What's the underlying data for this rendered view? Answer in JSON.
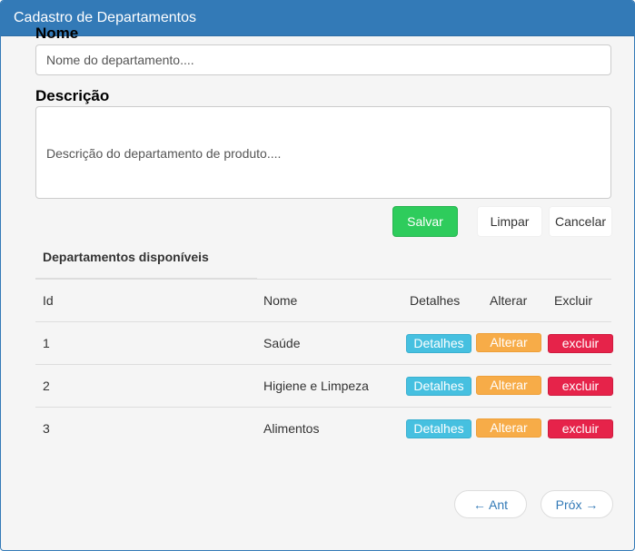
{
  "panel": {
    "title": "Cadastro de Departamentos"
  },
  "form": {
    "nome_label": "Nome",
    "nome_placeholder": "Nome do departamento....",
    "descricao_label": "Descrição",
    "descricao_placeholder": "Descrição do departamento de produto....",
    "save_label": "Salvar",
    "clear_label": "Limpar",
    "cancel_label": "Cancelar"
  },
  "table": {
    "title": "Departamentos disponíveis",
    "headers": [
      "Id",
      "Nome",
      "Detalhes",
      "Alterar",
      "Excluir"
    ],
    "rows": [
      {
        "id": "1",
        "nome": "Saúde",
        "detalhes": "Detalhes",
        "alterar": "Alterar",
        "excluir": "excluir"
      },
      {
        "id": "2",
        "nome": "Higiene e Limpeza",
        "detalhes": "Detalhes",
        "alterar": "Alterar",
        "excluir": "excluir"
      },
      {
        "id": "3",
        "nome": "Alimentos",
        "detalhes": "Detalhes",
        "alterar": "Alterar",
        "excluir": "excluir"
      }
    ]
  },
  "pagination": {
    "prev_label": "← Ant",
    "next_label": "Próx →"
  },
  "colors": {
    "primary": "#337ab7",
    "success": "#2ecc5c",
    "info": "#46c0e0",
    "warning": "#f7ac48",
    "danger": "#e6234a"
  }
}
